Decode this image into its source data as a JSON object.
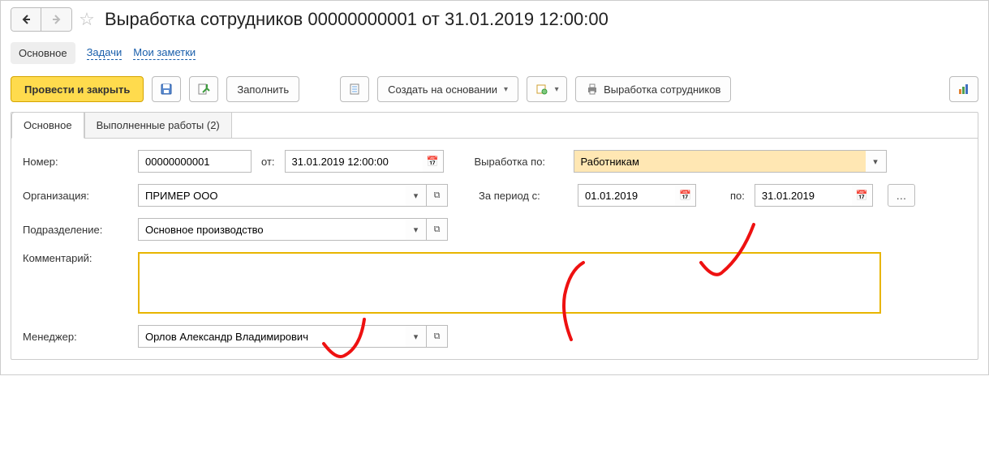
{
  "header": {
    "title": "Выработка сотрудников 00000000001 от 31.01.2019 12:00:00"
  },
  "nav_tabs": {
    "main": "Основное",
    "tasks": "Задачи",
    "notes": "Мои заметки"
  },
  "toolbar": {
    "post_close": "Провести и закрыть",
    "fill": "Заполнить",
    "create_based": "Создать на основании",
    "print_report": "Выработка сотрудников"
  },
  "form_tabs": {
    "main": "Основное",
    "done_work": "Выполненные работы (2)"
  },
  "form": {
    "number_label": "Номер:",
    "number_value": "00000000001",
    "from_label": "от:",
    "from_value": "31.01.2019 12:00:00",
    "vyabotka_po_label": "Выработка по:",
    "vyabotka_po_value": "Работникам",
    "org_label": "Организация:",
    "org_value": "ПРИМЕР ООО",
    "period_from_label": "За период с:",
    "period_from_value": "01.01.2019",
    "period_to_label": "по:",
    "period_to_value": "31.01.2019",
    "dept_label": "Подразделение:",
    "dept_value": "Основное производство",
    "comment_label": "Комментарий:",
    "comment_value": "",
    "manager_label": "Менеджер:",
    "manager_value": "Орлов Александр Владимирович"
  }
}
